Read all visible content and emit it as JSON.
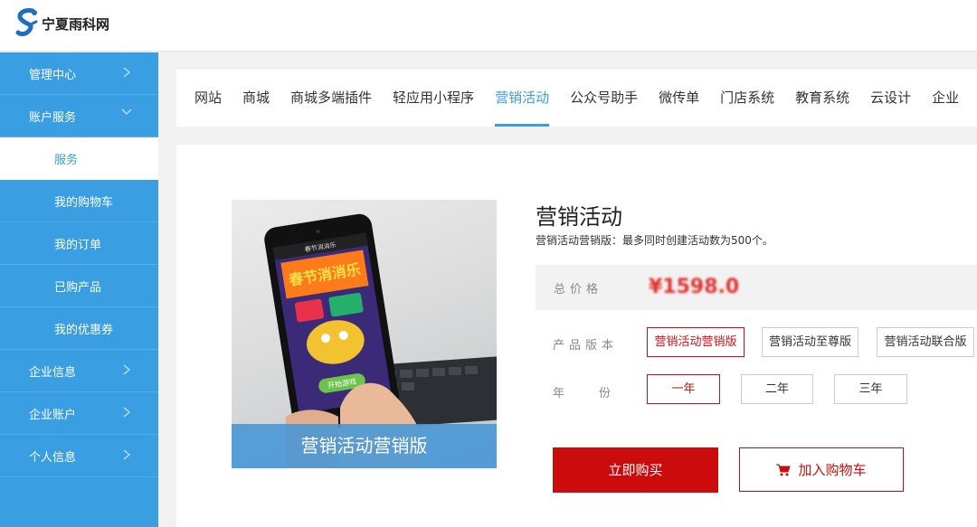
{
  "brand": {
    "name": "宁夏雨科网",
    "logo_icon": "yuke-logo-icon",
    "accent": "#3a9ee2"
  },
  "sidebar": {
    "items": [
      {
        "label": "管理中心",
        "type": "group",
        "expanded": false
      },
      {
        "label": "账户服务",
        "type": "group",
        "expanded": true
      },
      {
        "label": "服务",
        "type": "sub",
        "active": true
      },
      {
        "label": "我的购物车",
        "type": "sub"
      },
      {
        "label": "我的订单",
        "type": "sub"
      },
      {
        "label": "已购产品",
        "type": "sub"
      },
      {
        "label": "我的优惠券",
        "type": "sub"
      },
      {
        "label": "企业信息",
        "type": "group",
        "expanded": false
      },
      {
        "label": "企业账户",
        "type": "group",
        "expanded": false
      },
      {
        "label": "个人信息",
        "type": "group",
        "expanded": false
      }
    ]
  },
  "tabs": [
    "网站",
    "商城",
    "商城多端插件",
    "轻应用小程序",
    "营销活动",
    "公众号助手",
    "微传单",
    "门店系统",
    "教育系统",
    "云设计",
    "企业"
  ],
  "active_tab": "营销活动",
  "product": {
    "image_caption": "营销活动营销版",
    "image_screen_text": [
      "春节消消乐",
      "开始游戏"
    ],
    "title": "营销活动",
    "description": "营销活动营销版：最多同时创建活动数为500个。",
    "price_label": "总价格",
    "price": "¥1598.0",
    "version_label": "产品版本",
    "versions": [
      "营销活动营销版",
      "营销活动至尊版",
      "营销活动联合版"
    ],
    "selected_version": "营销活动营销版",
    "year_label": "年份",
    "years": [
      "一年",
      "二年",
      "三年"
    ],
    "selected_year": "一年",
    "buy_label": "立即购买",
    "cart_label": "加入购物车",
    "cart_icon": "cart-icon",
    "price_color": "#e03030",
    "button_color": "#cc0c0c"
  }
}
